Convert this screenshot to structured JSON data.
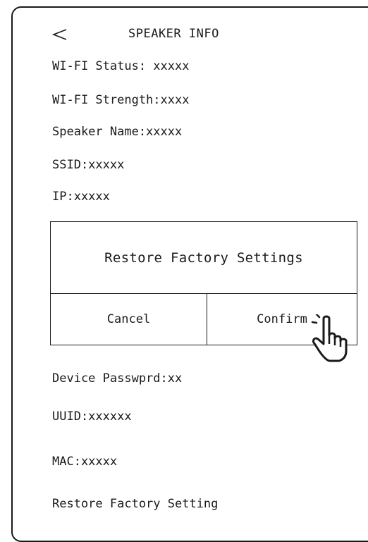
{
  "header": {
    "back_icon": "chevron-left-icon",
    "title": "SPEAKER INFO"
  },
  "info_top": [
    "WI-FI Status: xxxxx",
    "WI-FI Strength:xxxx",
    "Speaker Name:xxxxx",
    "SSID:xxxxx",
    "IP:xxxxx"
  ],
  "dialog": {
    "title": "Restore Factory Settings",
    "cancel_label": "Cancel",
    "confirm_label": "Confirm",
    "pointer_icon": "hand-pointer-icon"
  },
  "info_bottom": [
    "Device Passwprd:xx",
    "UUID:xxxxxx",
    "MAC:xxxxx",
    "Restore Factory Setting"
  ]
}
